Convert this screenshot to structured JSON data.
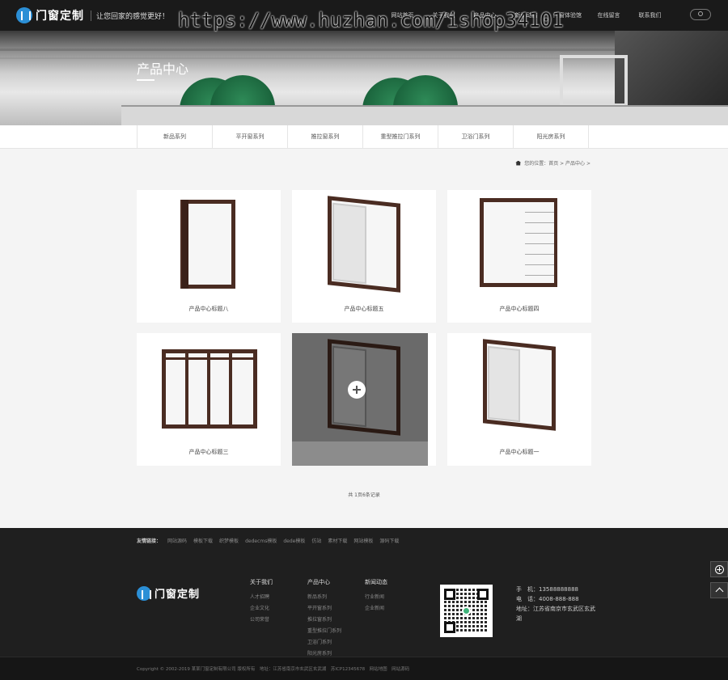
{
  "header": {
    "logo_text": "门窗定制",
    "slogan": "让您回家的感觉更好！",
    "nav": [
      "网站首页",
      "关于我们",
      "产品中心",
      "新闻动态",
      "门窗体验馆",
      "在线留言",
      "联系我们"
    ]
  },
  "watermark": "https://www.huzhan.com/ishop34101",
  "banner": {
    "title": "产品中心"
  },
  "subnav": [
    "新品系列",
    "平开窗系列",
    "推拉窗系列",
    "重型推拉门系列",
    "卫浴门系列",
    "阳光房系列"
  ],
  "breadcrumb": "您的位置：首页 > 产品中心 >",
  "products": [
    {
      "title": "产品中心标题八"
    },
    {
      "title": "产品中心标题五"
    },
    {
      "title": "产品中心标题四"
    },
    {
      "title": "产品中心标题三"
    },
    {
      "title": ""
    },
    {
      "title": "产品中心标题一"
    }
  ],
  "pager": "共 1页6条记录",
  "footer": {
    "links_label": "友情链接：",
    "links": [
      "网站源码",
      "模板下载",
      "织梦模板",
      "dedecms模板",
      "dede模板",
      "仿站",
      "素材下载",
      "网站模板",
      "源码下载"
    ],
    "logo_text": "门窗定制",
    "cols": [
      {
        "heading": "关于我们",
        "items": [
          "人才招聘",
          "企业文化",
          "公司荣誉"
        ]
      },
      {
        "heading": "产品中心",
        "items": [
          "新品系列",
          "平开窗系列",
          "推拉窗系列",
          "重型推拉门系列",
          "卫浴门系列",
          "阳光房系列"
        ]
      },
      {
        "heading": "新闻动态",
        "items": [
          "行业新闻",
          "企业新闻"
        ]
      }
    ],
    "contact": [
      "手　机：13588888888",
      "电　话：4008-888-888",
      "地址：江苏省南京市玄武区玄武湖"
    ],
    "copyright": "Copyright © 2002-2019 某某门窗定制有限公司 版权所有　地址：江苏省南京市玄武区玄武湖　苏ICP12345678　网站地图　网站源码"
  }
}
